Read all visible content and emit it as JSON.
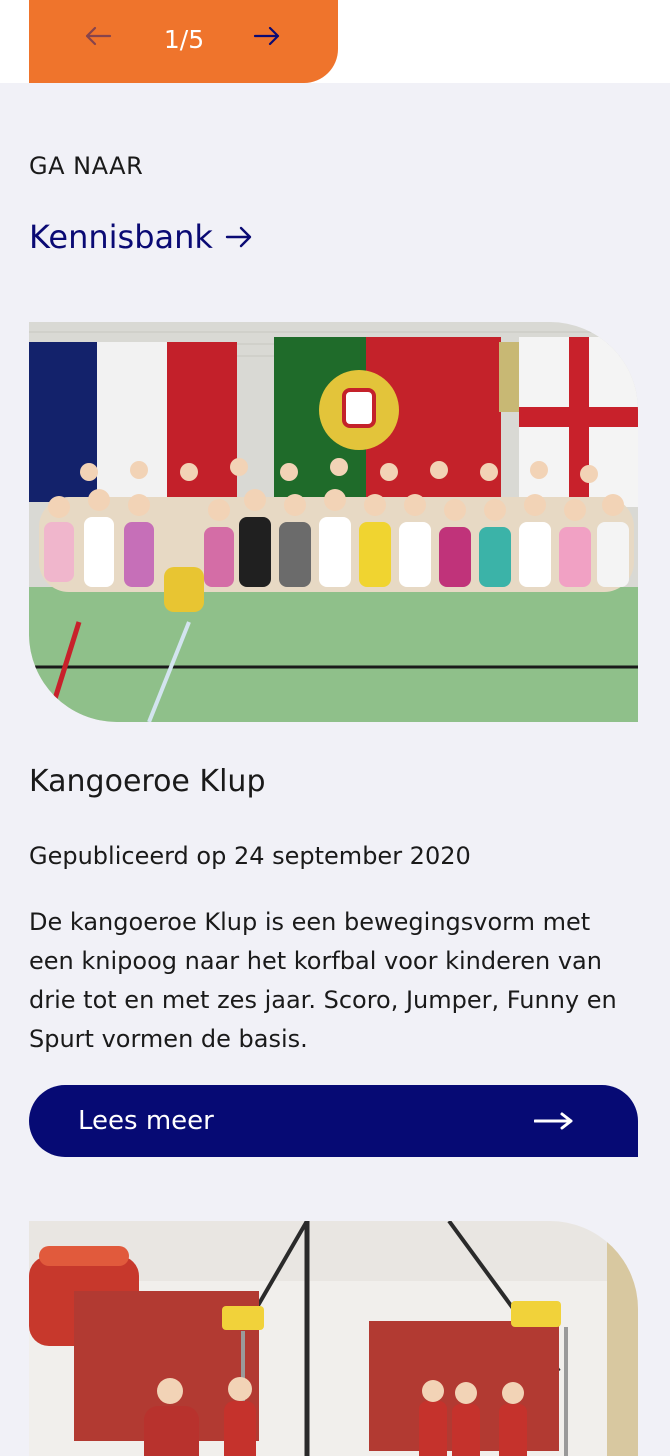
{
  "pager": {
    "current": "1/5",
    "prev_icon": "arrow-left-icon",
    "next_icon": "arrow-right-icon",
    "accent": "#ef742c"
  },
  "goto": {
    "label": "GA NAAR",
    "link_label": "Kennisbank",
    "link_icon": "arrow-right-icon",
    "link_color": "#0a0a74"
  },
  "article": {
    "title": "Kangoeroe Klup",
    "date": "Gepubliceerd op 24 september 2020",
    "description": "De kangoeroe Klup is een bewegingsvorm met een knipoog naar het korfbal voor kinderen van drie tot en met zes jaar. Scoro, Jumper, Funny en Spurt vormen de basis.",
    "button_label": "Lees meer",
    "button_icon": "arrow-right-icon",
    "button_color": "#060a74"
  },
  "next_article": {
    "image_icon": "photo-icon"
  }
}
